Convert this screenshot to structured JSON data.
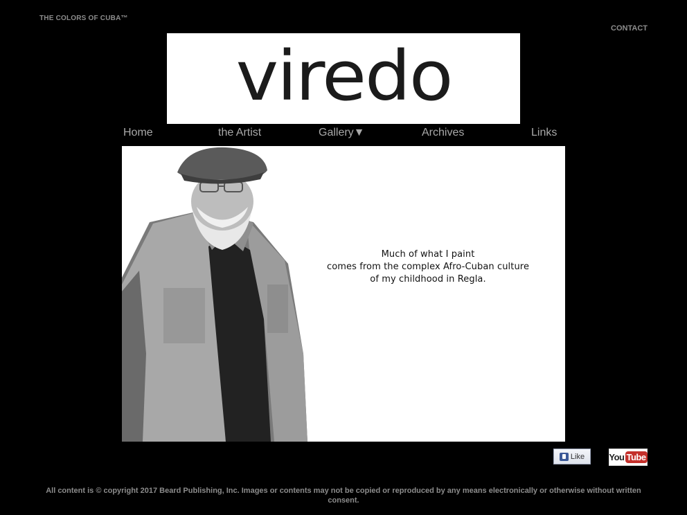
{
  "header": {
    "tagline": "THE COLORS OF CUBA™",
    "contact_label": "CONTACT"
  },
  "logo": {
    "text": "viredo"
  },
  "nav": {
    "items": [
      {
        "label": "Home"
      },
      {
        "label": "the Artist"
      },
      {
        "label": "Gallery▼"
      },
      {
        "label": "Archives"
      },
      {
        "label": "Links"
      }
    ]
  },
  "hero": {
    "quote_lines": [
      "Much of what I paint",
      "comes from the complex Afro-Cuban culture",
      "of my childhood in Regla."
    ]
  },
  "social": {
    "like_label": "Like",
    "youtube_you": "You",
    "youtube_tube": "Tube"
  },
  "footer": {
    "copyright": "All content is © copyright 2017 Beard Publishing, Inc. Images or contents may not be copied or reproduced by any means electronically or otherwise without written consent."
  }
}
